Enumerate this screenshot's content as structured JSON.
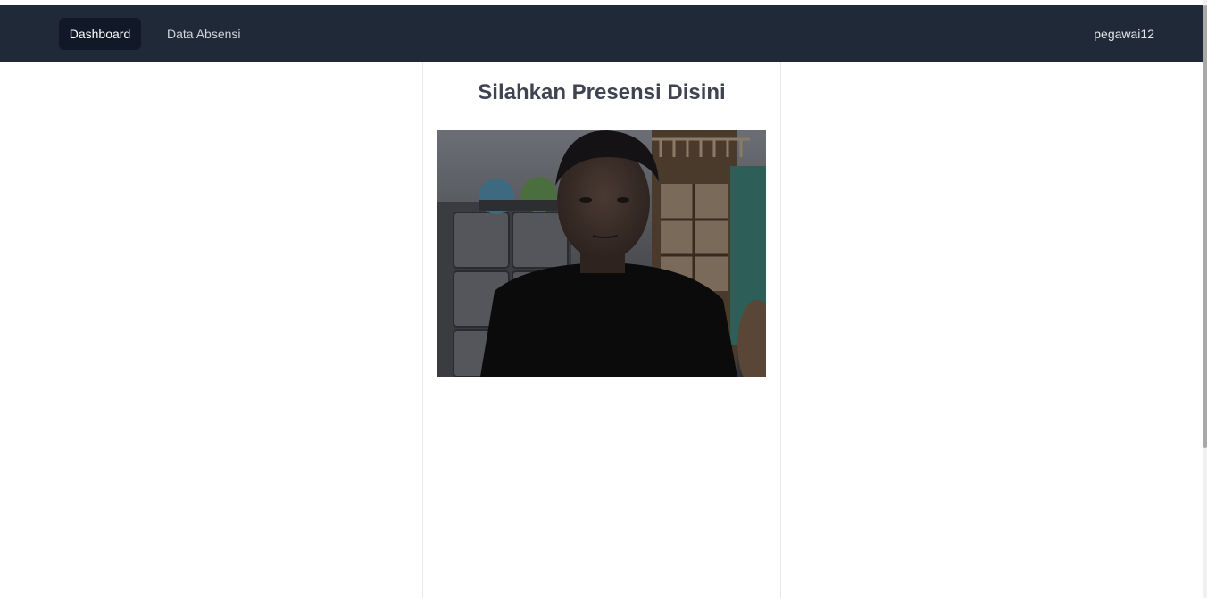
{
  "navbar": {
    "links": [
      {
        "label": "Dashboard",
        "active": true
      },
      {
        "label": "Data Absensi",
        "active": false
      }
    ],
    "user": "pegawai12"
  },
  "main": {
    "title": "Silahkan Presensi Disini",
    "camera": {
      "icon": "webcam-feed"
    }
  },
  "colors": {
    "navbar_bg": "#1f2937",
    "active_link_bg": "#111827",
    "title_color": "#3f4450"
  }
}
